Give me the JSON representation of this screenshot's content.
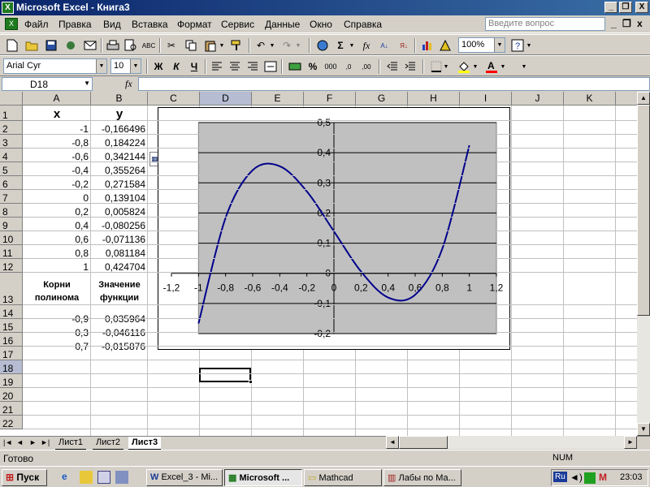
{
  "window": {
    "title": "Microsoft Excel - Книга3",
    "min": "_",
    "max": "❐",
    "close": "X"
  },
  "menu": {
    "items": [
      "Файл",
      "Правка",
      "Вид",
      "Вставка",
      "Формат",
      "Сервис",
      "Данные",
      "Окно",
      "Справка"
    ],
    "ask_placeholder": "Введите вопрос",
    "doc_min": "_",
    "doc_max": "❐",
    "doc_close": "x"
  },
  "toolbar": {
    "zoom": "100%",
    "font": "Arial Cyr",
    "size": "10",
    "bold": "Ж",
    "italic": "К",
    "underline": "Ч",
    "sum": "Σ",
    "fx": "fx",
    "percent": "%",
    "thousands": "000"
  },
  "formula_bar": {
    "cell_ref": "D18",
    "fx": "fx",
    "content": ""
  },
  "columns": [
    "A",
    "B",
    "C",
    "D",
    "E",
    "F",
    "G",
    "H",
    "I",
    "J",
    "K"
  ],
  "rows": [
    "1",
    "2",
    "3",
    "4",
    "5",
    "6",
    "7",
    "8",
    "9",
    "10",
    "11",
    "12",
    "13",
    "14",
    "15",
    "16",
    "17",
    "18",
    "19",
    "20",
    "21",
    "22"
  ],
  "cells": {
    "A1": "x",
    "B1": "y",
    "A2": "-1",
    "B2": "-0,166496",
    "A3": "-0,8",
    "B3": "0,184224",
    "A4": "-0,6",
    "B4": "0,342144",
    "A5": "-0,4",
    "B5": "0,355264",
    "A6": "-0,2",
    "B6": "0,271584",
    "A7": "0",
    "B7": "0,139104",
    "A8": "0,2",
    "B8": "0,005824",
    "A9": "0,4",
    "B9": "-0,080256",
    "A10": "0,6",
    "B10": "-0,071136",
    "A11": "0,8",
    "B11": "0,081184",
    "A12": "1",
    "B12": "0,424704",
    "A13a": "Корни",
    "A13b": "полинома",
    "B13a": "Значение",
    "B13b": "функции",
    "A14": "-0,9",
    "B14": "0,035964",
    "A15": "0,3",
    "B15": "-0,046116",
    "A16": "0,7",
    "B16": "-0,015876"
  },
  "chart_data": {
    "type": "line",
    "title": "",
    "xlabel": "",
    "ylabel": "",
    "xlim": [
      -1.2,
      1.2
    ],
    "ylim": [
      -0.2,
      0.5
    ],
    "x_ticks": [
      "-1,2",
      "-1",
      "-0,8",
      "-0,6",
      "-0,4",
      "-0,2",
      "0",
      "0,2",
      "0,4",
      "0,6",
      "0,8",
      "1",
      "1,2"
    ],
    "y_ticks": [
      "0,5",
      "0,4",
      "0,3",
      "0,2",
      "0,1",
      "0",
      "-0,1",
      "-0,2"
    ],
    "grid": true,
    "series": [
      {
        "x": [
          -1,
          -0.8,
          -0.6,
          -0.4,
          -0.2,
          0,
          0.2,
          0.4,
          0.6,
          0.8,
          1
        ],
        "y": [
          -0.166496,
          0.184224,
          0.342144,
          0.355264,
          0.271584,
          0.139104,
          0.005824,
          -0.080256,
          -0.071136,
          0.081184,
          0.424704
        ],
        "color": "#00008b"
      }
    ],
    "plot_bg": "#c0c0c0"
  },
  "sheet_tabs": [
    "Лист1",
    "Лист2",
    "Лист3"
  ],
  "active_sheet": "Лист3",
  "status": {
    "left": "Готово",
    "num": "NUM"
  },
  "taskbar": {
    "start": "Пуск",
    "tasks": [
      "Excel_3 - Mi...",
      "Microsoft ...",
      "Mathcad",
      "Лабы по Ма..."
    ],
    "lang": "Ru",
    "time": "23:03"
  }
}
